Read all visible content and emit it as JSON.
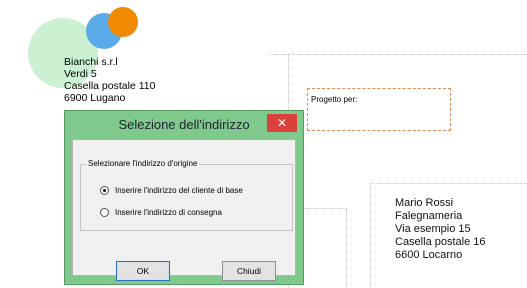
{
  "sender": {
    "lines": [
      "Bianchi s.r.l",
      "Verdi 5",
      "Casella postale 110",
      "6900 Lugano"
    ]
  },
  "project": {
    "label": "Progetto per:"
  },
  "recipient": {
    "lines": [
      "Mario Rossi",
      "Falegnameria",
      "Via esempio 15",
      "Casella postale 16",
      "6600 Locarno"
    ]
  },
  "dialog": {
    "title": "Selezione dell'indirizzo",
    "close_glyph": "✕",
    "group_label": "Selezionare l'indirizzo d'origine",
    "options": [
      {
        "label": "Inserire l'indirizzo del cliente di base",
        "selected": true
      },
      {
        "label": "Inserire l'indirizzo di consegna",
        "selected": false
      }
    ],
    "ok_label": "OK",
    "cancel_label": "Chiudi"
  },
  "colors": {
    "dialog_frame": "#7fc98c",
    "close_button": "#d9413a",
    "logo_green": "#c8f0d0",
    "logo_blue": "#5aa9e8",
    "logo_orange": "#f08a00",
    "project_border": "#e08a55"
  }
}
